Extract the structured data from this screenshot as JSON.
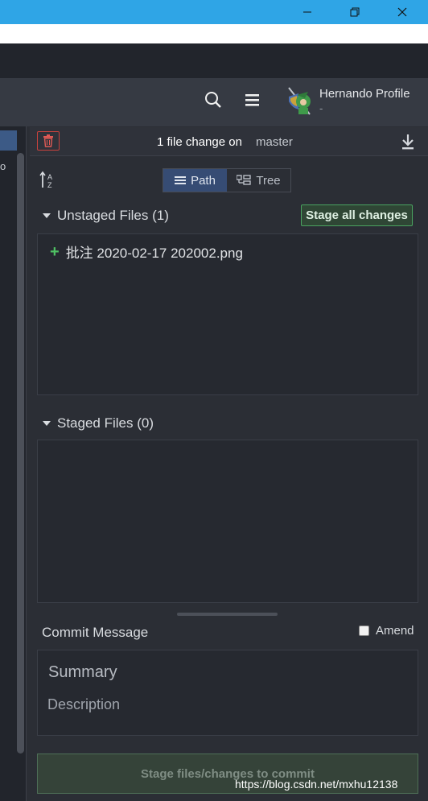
{
  "window": {
    "controls": {
      "minimize": "—",
      "maximize": "❐",
      "close": "✕"
    }
  },
  "header": {
    "profile_name": "Hernando Profile",
    "profile_sub": "-",
    "icons": [
      "search-icon",
      "menu-icon"
    ]
  },
  "left_pane": {
    "partial_text": "o"
  },
  "panel": {
    "change_count_text": "1 file change on",
    "branch": "master",
    "view_toggle": {
      "path_label": "Path",
      "tree_label": "Tree",
      "selected": "Path"
    },
    "unstaged": {
      "title": "Unstaged Files (1)",
      "stage_all_label": "Stage all changes",
      "files": [
        {
          "status": "+",
          "name": "批注 2020-02-17 202002.png"
        }
      ]
    },
    "staged": {
      "title": "Staged Files (0)"
    },
    "commit": {
      "title": "Commit Message",
      "amend_label": "Amend",
      "summary_placeholder": "Summary",
      "description_placeholder": "Description",
      "button_label": "Stage files/changes to commit"
    }
  },
  "watermark": "https://blog.csdn.net/mxhu12138",
  "colors": {
    "accent": "#2fa5e6",
    "stage_green": "#4aa360",
    "danger": "#c9423d",
    "selected_toggle": "#364c74"
  }
}
